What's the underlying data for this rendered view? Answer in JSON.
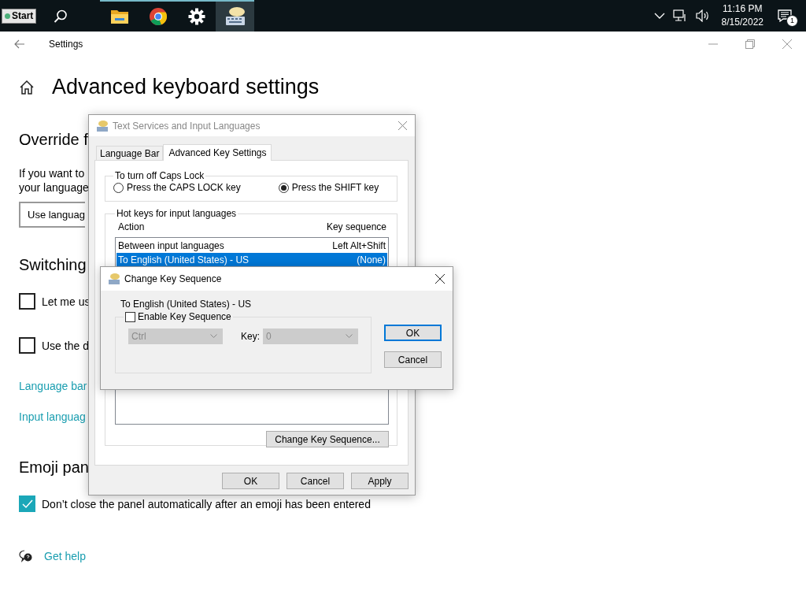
{
  "taskbar": {
    "start": "Start",
    "apps": [
      {
        "kind": "search",
        "running": false,
        "active": false
      },
      {
        "kind": "folder",
        "running": true,
        "active": false
      },
      {
        "kind": "browser",
        "running": true,
        "active": false
      },
      {
        "kind": "gear",
        "running": true,
        "active": false
      },
      {
        "kind": "keyboard",
        "running": true,
        "active": true
      }
    ],
    "time": "11:16 PM",
    "date": "8/15/2022",
    "notification_count": "1"
  },
  "settings": {
    "title": "Settings",
    "heading": "Advanced keyboard settings",
    "override_heading": "Override f",
    "override_text": [
      "If you want to",
      "your language"
    ],
    "override_dropdown": "Use languag",
    "switching_heading": "Switching",
    "switching_options": [
      {
        "label": "Let me us",
        "checked": false
      },
      {
        "label": "Use the d",
        "checked": false
      }
    ],
    "links": [
      "Language bar",
      "Input languag"
    ],
    "emoji_heading": "Emoji pan",
    "emoji_option": {
      "label": "Don’t close the panel automatically after an emoji has been entered",
      "checked": true
    },
    "help_link": "Get help"
  },
  "text_services": {
    "title": "Text Services and Input Languages",
    "tabs": [
      {
        "label": "Language Bar",
        "selected": false
      },
      {
        "label": "Advanced Key Settings",
        "selected": true
      }
    ],
    "caps_lock": {
      "legend": "To turn off Caps Lock",
      "options": [
        {
          "label": "Press the CAPS LOCK key",
          "selected": false
        },
        {
          "label": "Press the SHIFT key",
          "selected": true
        }
      ]
    },
    "hotkeys": {
      "legend": "Hot keys for input languages",
      "columns": [
        "Action",
        "Key sequence"
      ],
      "rows": [
        {
          "action": "Between input languages",
          "sequence": "Left Alt+Shift",
          "selected": false
        },
        {
          "action": "To English (United States) - US",
          "sequence": "(None)",
          "selected": true
        }
      ],
      "button": "Change Key Sequence..."
    },
    "buttons": [
      "OK",
      "Cancel",
      "Apply"
    ]
  },
  "change_key": {
    "title": "Change Key Sequence",
    "target": "To English (United States) - US",
    "enable": {
      "label": "Enable Key Sequence",
      "checked": false
    },
    "modifier": {
      "value": "Ctrl",
      "disabled": true
    },
    "key_label": "Key:",
    "key": {
      "value": "0",
      "disabled": true
    },
    "buttons": [
      {
        "label": "OK",
        "focused": true
      },
      {
        "label": "Cancel",
        "focused": false
      }
    ]
  }
}
